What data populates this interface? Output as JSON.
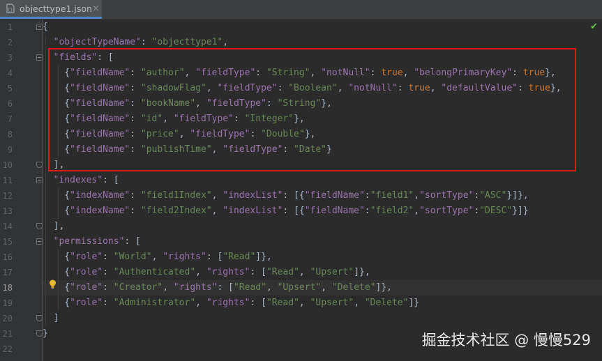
{
  "tab": {
    "filename": "objecttype1.json",
    "close_glyph": "×",
    "icon": "json-file-icon"
  },
  "status": {
    "check_glyph": "✔",
    "icon": "inspection-ok-icon"
  },
  "watermark": "掘金技术社区 @ 慢慢529",
  "current_line": 18,
  "colors": {
    "highlight_box": "#e0171b",
    "key": "#9876aa",
    "string": "#6a8759",
    "literal": "#cc7832",
    "punct": "#a9b7c6"
  },
  "lines": [
    [
      [
        "p",
        "{"
      ]
    ],
    [
      [
        "p",
        "  "
      ],
      [
        "k",
        "\"objectTypeName\""
      ],
      [
        "p",
        ": "
      ],
      [
        "s",
        "\"objecttype1\""
      ],
      [
        "p",
        ","
      ]
    ],
    [
      [
        "p",
        "  "
      ],
      [
        "k",
        "\"fields\""
      ],
      [
        "p",
        ": ["
      ]
    ],
    [
      [
        "p",
        "    {"
      ],
      [
        "k",
        "\"fieldName\""
      ],
      [
        "p",
        ": "
      ],
      [
        "s",
        "\"author\""
      ],
      [
        "p",
        ", "
      ],
      [
        "k",
        "\"fieldType\""
      ],
      [
        "p",
        ": "
      ],
      [
        "s",
        "\"String\""
      ],
      [
        "p",
        ", "
      ],
      [
        "k",
        "\"notNull\""
      ],
      [
        "p",
        ": "
      ],
      [
        "b",
        "true"
      ],
      [
        "p",
        ", "
      ],
      [
        "k",
        "\"belongPrimaryKey\""
      ],
      [
        "p",
        ": "
      ],
      [
        "b",
        "true"
      ],
      [
        "p",
        "},"
      ]
    ],
    [
      [
        "p",
        "    {"
      ],
      [
        "k",
        "\"fieldName\""
      ],
      [
        "p",
        ": "
      ],
      [
        "s",
        "\"shadowFlag\""
      ],
      [
        "p",
        ", "
      ],
      [
        "k",
        "\"fieldType\""
      ],
      [
        "p",
        ": "
      ],
      [
        "s",
        "\"Boolean\""
      ],
      [
        "p",
        ", "
      ],
      [
        "k",
        "\"notNull\""
      ],
      [
        "p",
        ": "
      ],
      [
        "b",
        "true"
      ],
      [
        "p",
        ", "
      ],
      [
        "k",
        "\"defaultValue\""
      ],
      [
        "p",
        ": "
      ],
      [
        "b",
        "true"
      ],
      [
        "p",
        "},"
      ]
    ],
    [
      [
        "p",
        "    {"
      ],
      [
        "k",
        "\"fieldName\""
      ],
      [
        "p",
        ": "
      ],
      [
        "s",
        "\"bookName\""
      ],
      [
        "p",
        ", "
      ],
      [
        "k",
        "\"fieldType\""
      ],
      [
        "p",
        ": "
      ],
      [
        "s",
        "\"String\""
      ],
      [
        "p",
        "},"
      ]
    ],
    [
      [
        "p",
        "    {"
      ],
      [
        "k",
        "\"fieldName\""
      ],
      [
        "p",
        ": "
      ],
      [
        "s",
        "\"id\""
      ],
      [
        "p",
        ", "
      ],
      [
        "k",
        "\"fieldType\""
      ],
      [
        "p",
        ": "
      ],
      [
        "s",
        "\"Integer\""
      ],
      [
        "p",
        "},"
      ]
    ],
    [
      [
        "p",
        "    {"
      ],
      [
        "k",
        "\"fieldName\""
      ],
      [
        "p",
        ": "
      ],
      [
        "s",
        "\"price\""
      ],
      [
        "p",
        ", "
      ],
      [
        "k",
        "\"fieldType\""
      ],
      [
        "p",
        ": "
      ],
      [
        "s",
        "\"Double\""
      ],
      [
        "p",
        "},"
      ]
    ],
    [
      [
        "p",
        "    {"
      ],
      [
        "k",
        "\"fieldName\""
      ],
      [
        "p",
        ": "
      ],
      [
        "s",
        "\"publishTime\""
      ],
      [
        "p",
        ", "
      ],
      [
        "k",
        "\"fieldType\""
      ],
      [
        "p",
        ": "
      ],
      [
        "s",
        "\"Date\""
      ],
      [
        "p",
        "}"
      ]
    ],
    [
      [
        "p",
        "  ],"
      ]
    ],
    [
      [
        "p",
        "  "
      ],
      [
        "k",
        "\"indexes\""
      ],
      [
        "p",
        ": ["
      ]
    ],
    [
      [
        "p",
        "    {"
      ],
      [
        "k",
        "\"indexName\""
      ],
      [
        "p",
        ": "
      ],
      [
        "s",
        "\"field1Index\""
      ],
      [
        "p",
        ", "
      ],
      [
        "k",
        "\"indexList\""
      ],
      [
        "p",
        ": [{"
      ],
      [
        "k",
        "\"fieldName\""
      ],
      [
        "p",
        ":"
      ],
      [
        "s",
        "\"field1\""
      ],
      [
        "p",
        ","
      ],
      [
        "k",
        "\"sortType\""
      ],
      [
        "p",
        ":"
      ],
      [
        "s",
        "\"ASC\""
      ],
      [
        "p",
        "}]},"
      ]
    ],
    [
      [
        "p",
        "    {"
      ],
      [
        "k",
        "\"indexName\""
      ],
      [
        "p",
        ": "
      ],
      [
        "s",
        "\"field2Index\""
      ],
      [
        "p",
        ", "
      ],
      [
        "k",
        "\"indexList\""
      ],
      [
        "p",
        ": [{"
      ],
      [
        "k",
        "\"fieldName\""
      ],
      [
        "p",
        ":"
      ],
      [
        "s",
        "\"field2\""
      ],
      [
        "p",
        ","
      ],
      [
        "k",
        "\"sortType\""
      ],
      [
        "p",
        ":"
      ],
      [
        "s",
        "\"DESC\""
      ],
      [
        "p",
        "}]}"
      ]
    ],
    [
      [
        "p",
        "  ],"
      ]
    ],
    [
      [
        "p",
        "  "
      ],
      [
        "k",
        "\"permissions\""
      ],
      [
        "p",
        ": ["
      ]
    ],
    [
      [
        "p",
        "    {"
      ],
      [
        "k",
        "\"role\""
      ],
      [
        "p",
        ": "
      ],
      [
        "s",
        "\"World\""
      ],
      [
        "p",
        ", "
      ],
      [
        "k",
        "\"rights\""
      ],
      [
        "p",
        ": ["
      ],
      [
        "s",
        "\"Read\""
      ],
      [
        "p",
        "]},"
      ]
    ],
    [
      [
        "p",
        "    {"
      ],
      [
        "k",
        "\"role\""
      ],
      [
        "p",
        ": "
      ],
      [
        "s",
        "\"Authenticated\""
      ],
      [
        "p",
        ", "
      ],
      [
        "k",
        "\"rights\""
      ],
      [
        "p",
        ": ["
      ],
      [
        "s",
        "\"Read\""
      ],
      [
        "p",
        ", "
      ],
      [
        "s",
        "\"Upsert\""
      ],
      [
        "p",
        "]},"
      ]
    ],
    [
      [
        "p",
        "    {"
      ],
      [
        "k",
        "\"role\""
      ],
      [
        "p",
        ": "
      ],
      [
        "s",
        "\"Creator\""
      ],
      [
        "p",
        ", "
      ],
      [
        "k",
        "\"rights\""
      ],
      [
        "p",
        ": ["
      ],
      [
        "s",
        "\"Read\""
      ],
      [
        "p",
        ", "
      ],
      [
        "s",
        "\"Upsert\""
      ],
      [
        "p",
        ", "
      ],
      [
        "s",
        "\"Delete\""
      ],
      [
        "p",
        "]},"
      ]
    ],
    [
      [
        "p",
        "    {"
      ],
      [
        "k",
        "\"role\""
      ],
      [
        "p",
        ": "
      ],
      [
        "s",
        "\"Administrator\""
      ],
      [
        "p",
        ", "
      ],
      [
        "k",
        "\"rights\""
      ],
      [
        "p",
        ": ["
      ],
      [
        "s",
        "\"Read\""
      ],
      [
        "p",
        ", "
      ],
      [
        "s",
        "\"Upsert\""
      ],
      [
        "p",
        ", "
      ],
      [
        "s",
        "\"Delete\""
      ],
      [
        "p",
        "]}"
      ]
    ],
    [
      [
        "p",
        "  ]"
      ]
    ],
    [
      [
        "p",
        "}"
      ]
    ],
    []
  ]
}
